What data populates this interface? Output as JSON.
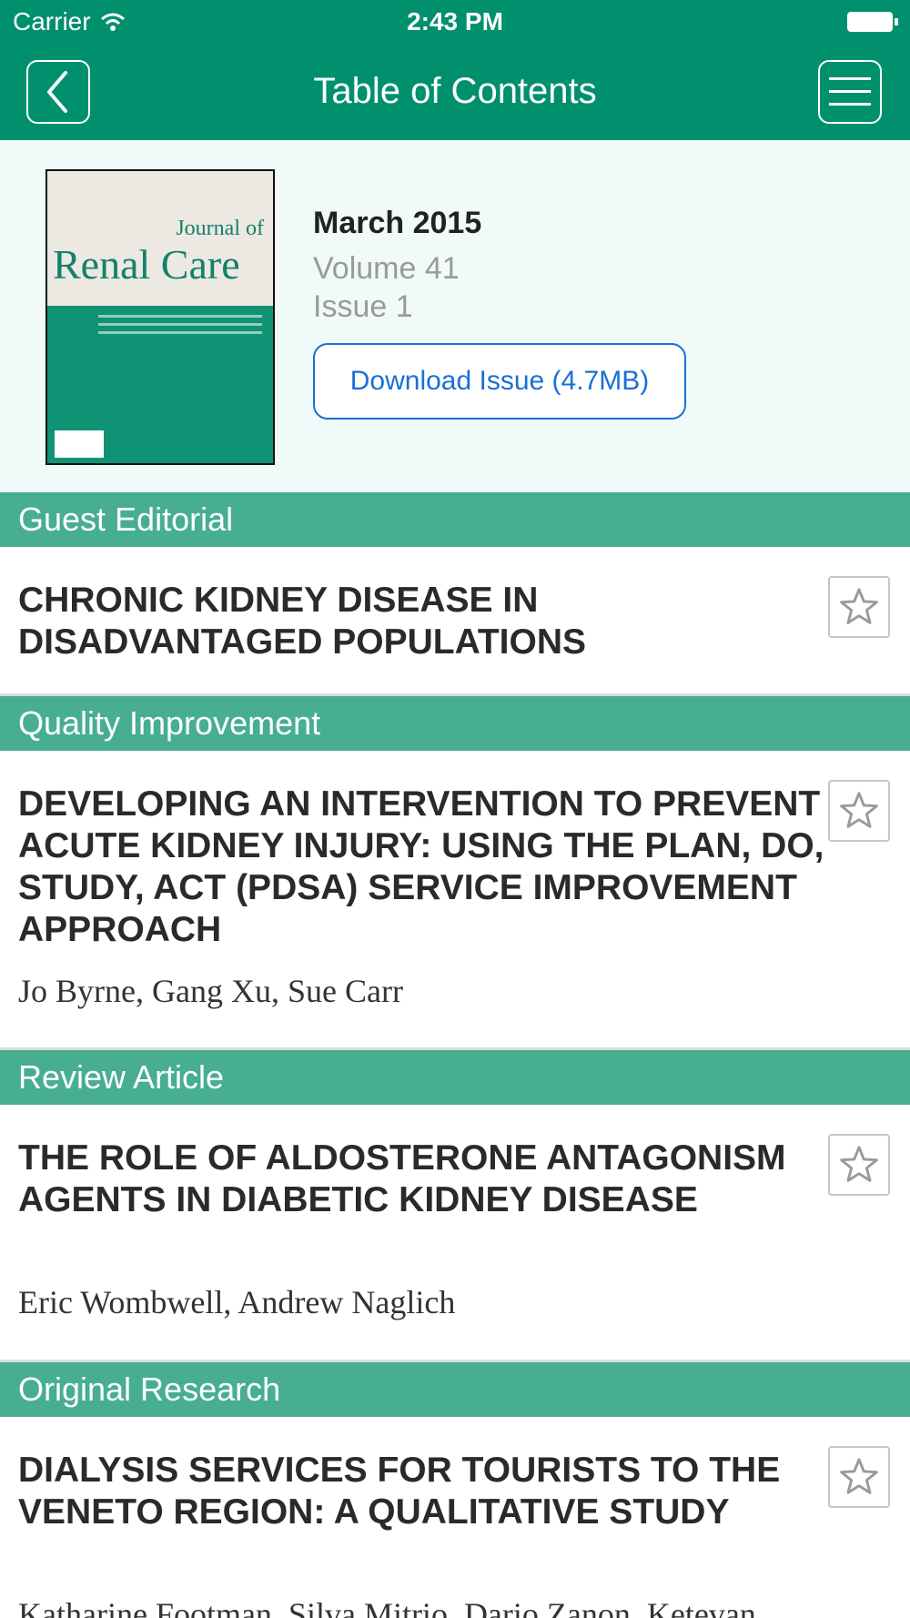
{
  "status_bar": {
    "carrier": "Carrier",
    "time": "2:43 PM"
  },
  "nav": {
    "title": "Table of Contents",
    "back_icon": "chevron-left-icon",
    "menu_icon": "hamburger-menu-icon"
  },
  "issue": {
    "cover_title_line1": "Journal of",
    "cover_title_line2": "Renal Care",
    "date": "March 2015",
    "volume": "Volume 41",
    "issue": "Issue 1",
    "download_label": "Download Issue (4.7MB)"
  },
  "sections": [
    {
      "name": "Guest Editorial",
      "article": {
        "title": "CHRONIC KIDNEY DISEASE IN DISADVANTAGED POPULATIONS",
        "authors": ""
      }
    },
    {
      "name": "Quality Improvement",
      "article": {
        "title": "DEVELOPING AN INTERVENTION TO PREVENT ACUTE KIDNEY INJURY: USING THE PLAN, DO, STUDY, ACT (PDSA) SERVICE IMPROVEMENT APPROACH",
        "authors": "Jo Byrne, Gang Xu, Sue Carr"
      }
    },
    {
      "name": "Review Article",
      "article": {
        "title": "THE ROLE OF ALDOSTERONE ANTAGONISM AGENTS IN DIABETIC KIDNEY DISEASE",
        "authors": "Eric Wombwell, Andrew Naglich"
      }
    },
    {
      "name": "Original Research",
      "article": {
        "title": "DIALYSIS SERVICES FOR TOURISTS TO THE VENETO REGION: A QUALITATIVE STUDY",
        "authors": "Katharine Footman, Silva Mitrio, Dario Zanon, Ketevan"
      }
    }
  ],
  "colors": {
    "primary": "#00906e",
    "section_header": "#47ae92",
    "header_bg": "#effaf9",
    "link": "#1a6fd8"
  }
}
